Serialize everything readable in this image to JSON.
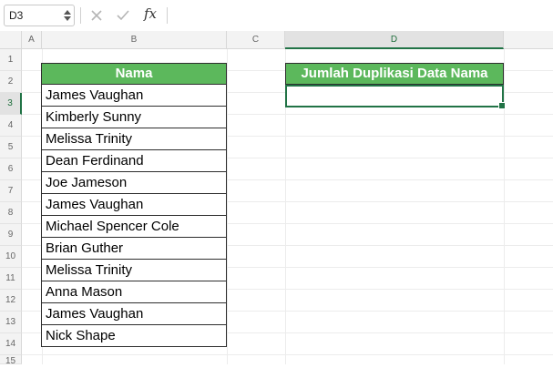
{
  "formula_bar": {
    "name_box": "D3",
    "cancel_icon": "x-icon",
    "enter_icon": "check-icon",
    "function_label": "fx",
    "formula": ""
  },
  "columns": [
    "A",
    "B",
    "C",
    "D"
  ],
  "active_column": "D",
  "rows": [
    "1",
    "2",
    "3",
    "4",
    "5",
    "6",
    "7",
    "8",
    "9",
    "10",
    "11",
    "12",
    "13",
    "14",
    "15"
  ],
  "active_row": "3",
  "table": {
    "header": "Nama",
    "names": [
      "James Vaughan",
      "Kimberly Sunny",
      "Melissa Trinity",
      "Dean Ferdinand",
      "Joe Jameson",
      "James Vaughan",
      "Michael Spencer Cole",
      "Brian Guther",
      "Melissa Trinity",
      "Anna Mason",
      "James Vaughan",
      "Nick Shape"
    ]
  },
  "result": {
    "header": "Jumlah Duplikasi Data Nama",
    "value": ""
  },
  "colors": {
    "header_green": "#5cb85c",
    "selection_green": "#217346"
  }
}
